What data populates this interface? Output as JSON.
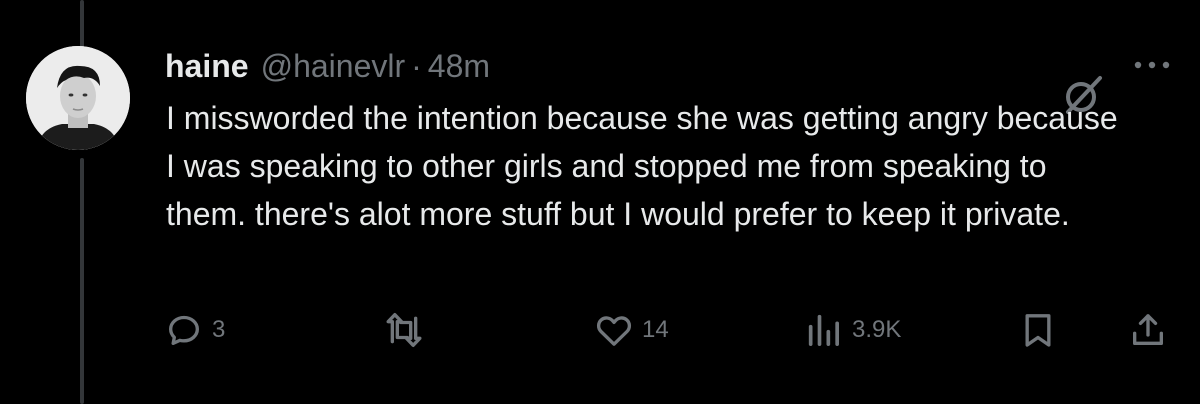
{
  "tweet": {
    "display_name": "haine",
    "handle": "@hainevlr",
    "separator": "·",
    "time": "48m",
    "text": "I missworded the intention because she was getting angry because I was speaking to other girls and stopped me from speaking to them. there's alot more stuff but I would prefer to keep it private."
  },
  "actions": {
    "reply_count": "3",
    "like_count": "14",
    "views_count": "3.9K"
  },
  "icons": {
    "reply": "reply-icon",
    "retweet": "retweet-icon",
    "like": "heart-icon",
    "views": "views-icon",
    "bookmark": "bookmark-icon",
    "share": "share-icon",
    "grok": "grok-icon",
    "more": "more-icon"
  },
  "colors": {
    "background": "#000000",
    "text": "#e7e9ea",
    "secondary": "#71767b",
    "thread_line": "#333639"
  }
}
